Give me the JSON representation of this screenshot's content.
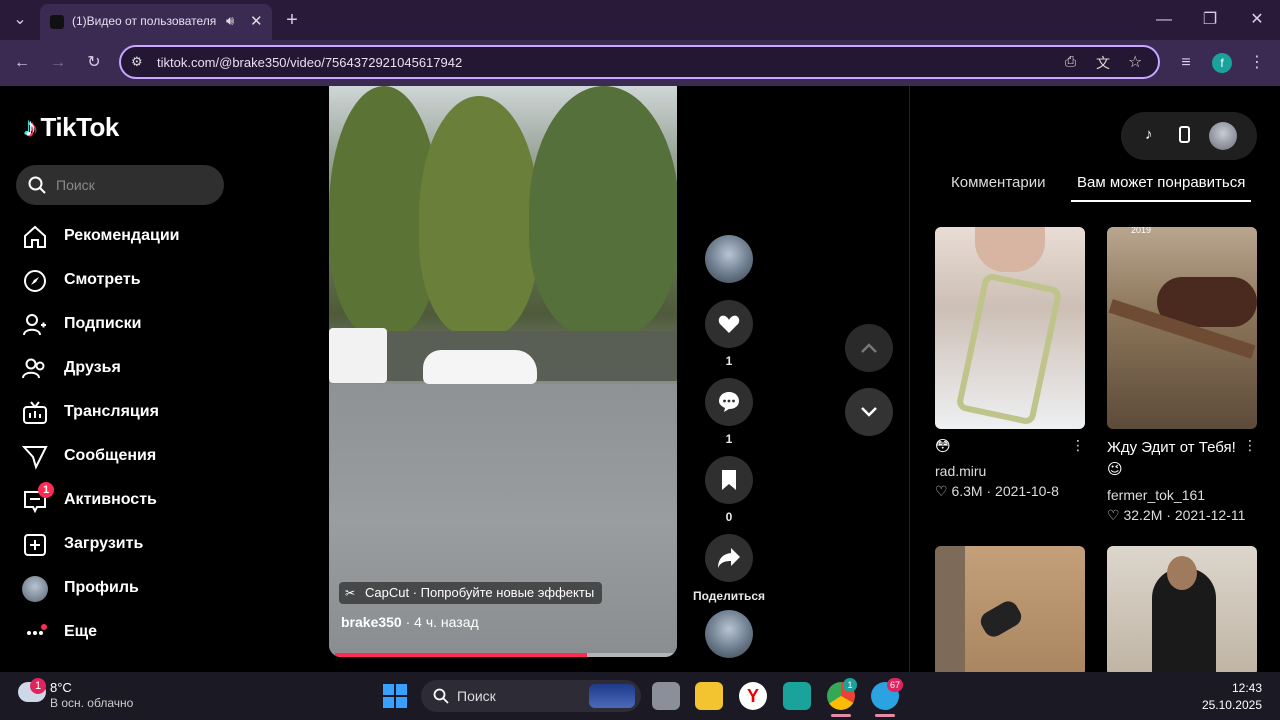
{
  "browser": {
    "tab_title": "(1)Видео от пользователя",
    "url": "tiktok.com/@brake350/video/7564372921045617942",
    "profile_initial": "f"
  },
  "sidebar": {
    "logo": "TikTok",
    "search_placeholder": "Поиск",
    "items": [
      {
        "label": "Рекомендации",
        "icon": "home-icon"
      },
      {
        "label": "Смотреть",
        "icon": "compass-icon"
      },
      {
        "label": "Подписки",
        "icon": "following-icon"
      },
      {
        "label": "Друзья",
        "icon": "friends-icon"
      },
      {
        "label": "Трансляция",
        "icon": "live-icon"
      },
      {
        "label": "Сообщения",
        "icon": "messages-icon"
      },
      {
        "label": "Активность",
        "icon": "activity-icon",
        "badge": "1"
      },
      {
        "label": "Загрузить",
        "icon": "upload-icon"
      },
      {
        "label": "Профиль",
        "icon": "avatar-icon"
      },
      {
        "label": "Еще",
        "icon": "more-icon"
      }
    ]
  },
  "video": {
    "effect_label": "CapCut · Попробуйте новые эффекты",
    "author": "brake350",
    "posted": "· 4 ч. назад",
    "progress_fraction": 0.74
  },
  "actions": {
    "likes": "1",
    "comments": "1",
    "saves": "0",
    "share_label": "Поделиться"
  },
  "right_panel": {
    "tabs": [
      "Комментарии",
      "Вам может понравиться"
    ],
    "active_tab": 1,
    "cards": [
      {
        "title": "😳",
        "author": "rad.miru",
        "likes": "6.3M",
        "date": "2021-10-8"
      },
      {
        "title": "Жду Эдит от Тебя! 😉",
        "author": "fermer_tok_161",
        "likes": "32.2M",
        "date": "2021-12-11",
        "thumb_text": "2019"
      },
      {
        "title": "",
        "author": "",
        "likes": "",
        "date": ""
      },
      {
        "title": "",
        "author": "",
        "likes": "",
        "date": ""
      }
    ]
  },
  "taskbar": {
    "weather_temp": "8°C",
    "weather_desc": "В осн. облачно",
    "weather_badge": "1",
    "search_label": "Поиск",
    "chrome_badge": "1",
    "telegram_badge": "67",
    "time": "12:43",
    "date": "25.10.2025"
  },
  "colors": {
    "accent": "#fe2c55",
    "browser_frame": "#3b2a52",
    "omnibox_border": "#c9a6ff"
  }
}
